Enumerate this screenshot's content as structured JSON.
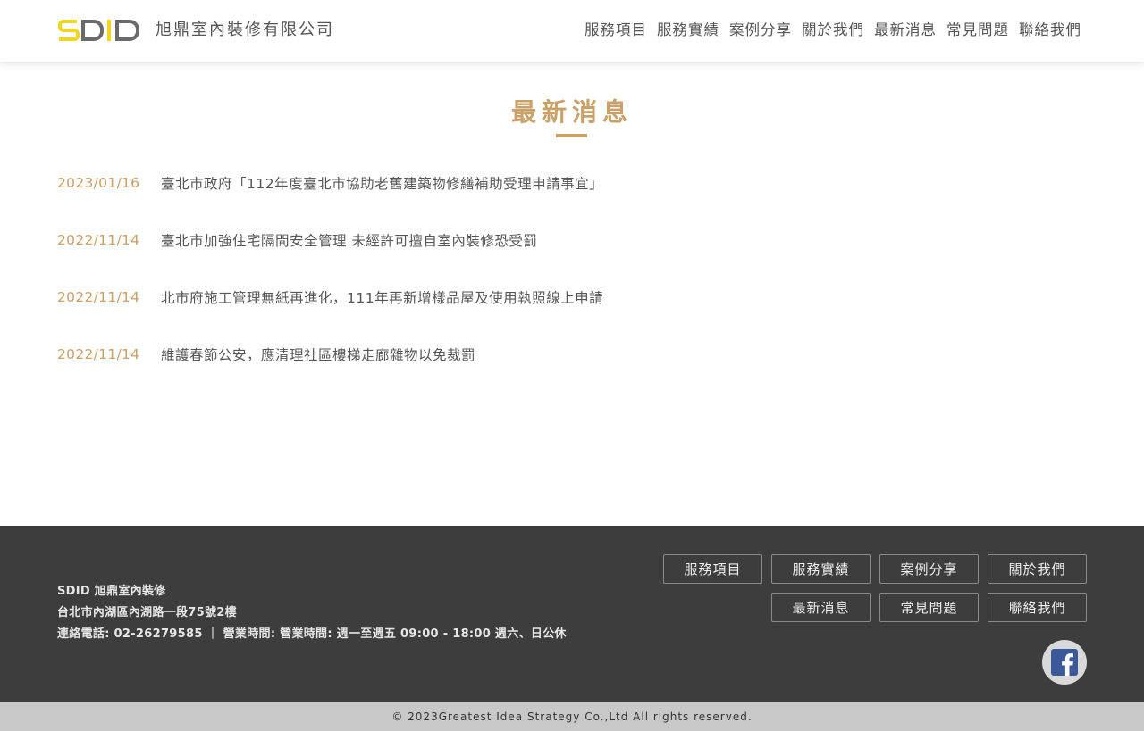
{
  "brand": {
    "logo_letters": [
      "S",
      "D",
      "I",
      "D"
    ],
    "name": "旭鼎室內裝修有限公司",
    "colors": {
      "logo_yellow": "#f2d51e",
      "logo_gray": "#6a6a6a",
      "accent_gold": "#c8a068"
    }
  },
  "nav": {
    "items": [
      "服務項目",
      "服務實績",
      "案例分享",
      "關於我們",
      "最新消息",
      "常見問題",
      "聯絡我們"
    ]
  },
  "page": {
    "title": "最新消息"
  },
  "news": [
    {
      "date": "2023/01/16",
      "title": "臺北市政府「112年度臺北市協助老舊建築物修繕補助受理申請事宜」"
    },
    {
      "date": "2022/11/14",
      "title": "臺北市加強住宅隔間安全管理 未經許可擅自室內裝修恐受罰"
    },
    {
      "date": "2022/11/14",
      "title": "北市府施工管理無紙再進化，111年再新增樣品屋及使用執照線上申請"
    },
    {
      "date": "2022/11/14",
      "title": "維護春節公安，應清理社區樓梯走廊雜物以免裁罰"
    }
  ],
  "footer": {
    "company": "SDID 旭鼎室內裝修",
    "address": "台北市內湖區內湖路一段75號2樓",
    "contact": "連絡電話: 02-26279585 ｜ 營業時間: 營業時間: 週一至週五 09:00 - 18:00 週六、日公休",
    "buttons": [
      "服務項目",
      "服務實績",
      "案例分享",
      "關於我們",
      "最新消息",
      "常見問題",
      "聯絡我們"
    ],
    "social_icon": "facebook-icon",
    "copyright": "© 2023Greatest Idea Strategy Co.,Ltd All rights reserved."
  }
}
